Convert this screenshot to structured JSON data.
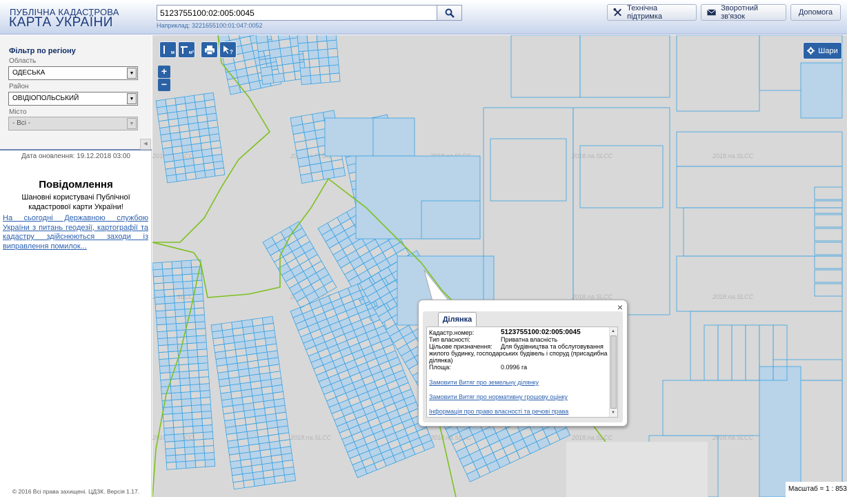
{
  "header": {
    "logo_line1": "ПУБЛІЧНА КАДАСТРОВА",
    "logo_line2": "КАРТА УКРАЇНИ",
    "search_value": "5123755100:02:005:0045",
    "search_hint": "Наприклад: 3221655100:01:047:0052",
    "buttons": [
      {
        "label": "Технічна підтримка",
        "icon": "tools-icon"
      },
      {
        "label": "Зворотний зв'язок",
        "icon": "envelope-icon"
      },
      {
        "label": "Допомога"
      }
    ]
  },
  "sidebar": {
    "filter_title": "Фільтр по регіону",
    "region_label": "Область",
    "region_value": "ОДЕСЬКА",
    "district_label": "Район",
    "district_value": "ОВІДІОПОЛЬСЬКИЙ",
    "city_label": "Місто",
    "city_value": "- Всі -",
    "update_date": "Дата оновлення: 19.12.2018 03:00",
    "message_title": "Повідомлення",
    "message_body": "Шановні користувачі Публічної кадастрової карти України!",
    "message_link": "На сьогодні Державною службою України з питань геодезії, картографії та кадастру здійснюються заходи із виправлення помилок...",
    "footer": "© 2016 Всі права захищені. ЦДЗК. Версія 1.17."
  },
  "map": {
    "tools": [
      {
        "label": "I м",
        "icon": "ruler-line-icon"
      },
      {
        "label": "I м²",
        "icon": "ruler-area-icon"
      },
      {
        "label": "",
        "icon": "print-icon"
      },
      {
        "label": "?",
        "icon": "identify-icon"
      }
    ],
    "zoom_in": "+",
    "zoom_out": "−",
    "layers_label": "Шари",
    "scale": "Масштаб = 1 : 8531",
    "watermark": "2018.na.SLCC",
    "parcel_color": "#3aa3e3",
    "boundary_color": "#7dc11f",
    "fill_color": "#b9d3e9"
  },
  "popup": {
    "tab": "Ділянка",
    "fields": [
      {
        "key": "Кадастр.номер:",
        "value": "5123755100:02:005:0045"
      },
      {
        "key": "Тип власності:",
        "value": "Приватна власність"
      },
      {
        "key": "Цільове призначення:",
        "value": "Для будівництва та обслуговування жилого будинку, господарських будівель і споруд (присадибна ділянка)"
      },
      {
        "key": "Площа:",
        "value": "0.0996 га"
      }
    ],
    "links": [
      "Замовити Витяг про земельну ділянку",
      "Замовити Витяг про нормативну грошову оцінку",
      "Інформація про право власності та речові права"
    ],
    "close": "×"
  }
}
